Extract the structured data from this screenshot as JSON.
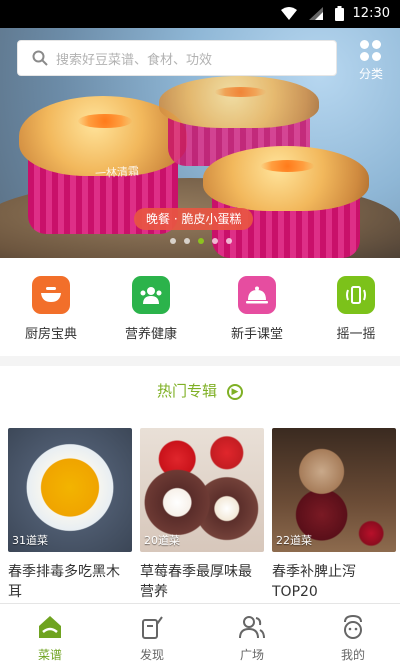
{
  "status_bar": {
    "time": "12:30"
  },
  "search": {
    "placeholder": "搜索好豆菜谱、食材、功效"
  },
  "category": {
    "label": "分类"
  },
  "banner": {
    "caption": "晚餐 · 脆皮小蛋糕",
    "watermark": "一林清霜",
    "dot_count": 5,
    "active_dot": 2
  },
  "quick_nav": [
    {
      "label": "厨房宝典",
      "icon": "bowl-icon",
      "color": "#f26f2a"
    },
    {
      "label": "营养健康",
      "icon": "people-icon",
      "color": "#2bb34b"
    },
    {
      "label": "新手课堂",
      "icon": "cloche-icon",
      "color": "#e64da0"
    },
    {
      "label": "摇一摇",
      "icon": "shake-phone-icon",
      "color": "#7cc21a"
    }
  ],
  "hot_section": {
    "title": "热门专辑"
  },
  "cards": [
    {
      "title": "春季排毒多吃黑木耳",
      "count": "31道菜"
    },
    {
      "title": "草莓春季最厚味最营养",
      "count": "20道菜"
    },
    {
      "title": "春季补脾止泻TOP20",
      "count": "22道菜"
    }
  ],
  "tabs": [
    {
      "label": "菜谱",
      "icon": "home-icon",
      "active": true
    },
    {
      "label": "发现",
      "icon": "discover-icon",
      "active": false
    },
    {
      "label": "广场",
      "icon": "people-square-icon",
      "active": false
    },
    {
      "label": "我的",
      "icon": "profile-icon",
      "active": false
    }
  ],
  "colors": {
    "accent": "#7fb025",
    "tab_active": "#6fa320"
  }
}
